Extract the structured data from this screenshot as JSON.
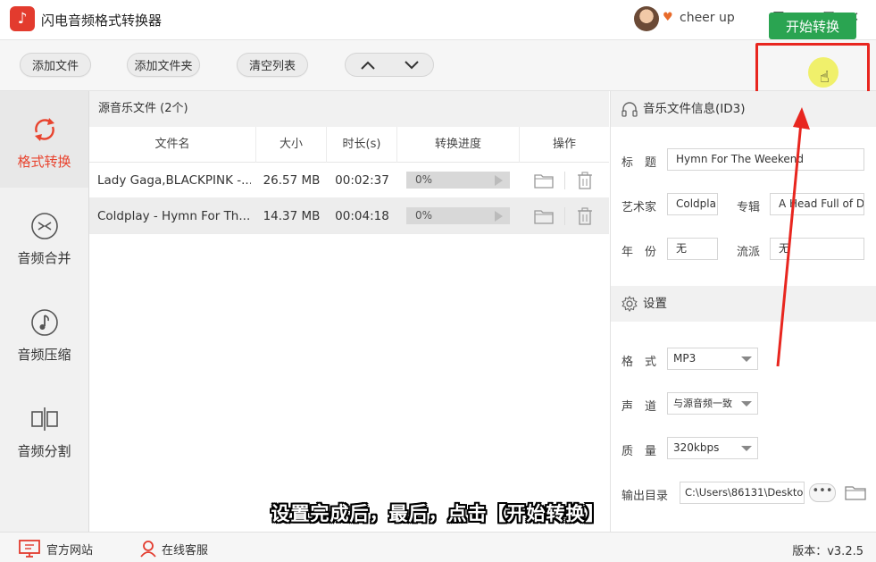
{
  "app": {
    "title": "闪电音频格式转换器",
    "logo_glyph": "♪"
  },
  "user": {
    "name": "cheer up"
  },
  "window_controls": {
    "menu": "☰",
    "minimize": "—",
    "maximize": "☐",
    "close": "✕"
  },
  "toolbar": {
    "add_file": "添加文件",
    "add_folder": "添加文件夹",
    "clear_list": "清空列表",
    "move_up": "︿",
    "move_down": "﹀",
    "start": "开始转换"
  },
  "sidebar": {
    "items": [
      {
        "label": "格式转换",
        "icon": "refresh-icon",
        "active": true
      },
      {
        "label": "音频合并",
        "icon": "merge-icon",
        "active": false
      },
      {
        "label": "音频压缩",
        "icon": "music-note-icon",
        "active": false
      },
      {
        "label": "音频分割",
        "icon": "split-icon",
        "active": false
      }
    ]
  },
  "file_list": {
    "header": "源音乐文件 (2个)",
    "columns": [
      "文件名",
      "大小",
      "时长(s)",
      "转换进度",
      "操作"
    ],
    "rows": [
      {
        "name": "Lady Gaga,BLACKPINK -...",
        "size": "26.57 MB",
        "duration": "00:02:37",
        "progress": "0%"
      },
      {
        "name": "Coldplay - Hymn For Th...",
        "size": "14.37 MB",
        "duration": "00:04:18",
        "progress": "0%"
      }
    ]
  },
  "info": {
    "header": "音乐文件信息(ID3)",
    "title_label": "标　题",
    "title_value": "Hymn For The Weekend",
    "artist_label": "艺术家",
    "artist_value": "Coldpla",
    "album_label": "专辑",
    "album_value": "A Head Full of D",
    "year_label": "年　份",
    "year_value": "无",
    "genre_label": "流派",
    "genre_value": "无"
  },
  "settings": {
    "header": "设置",
    "format_label": "格　式",
    "format_value": "MP3",
    "channel_label": "声　道",
    "channel_value": "与源音频一致",
    "quality_label": "质　量",
    "quality_value": "320kbps",
    "output_label": "输出目录",
    "output_value": "C:\\Users\\86131\\Deskto",
    "dots": "•••"
  },
  "caption": "设置完成后，最后，点击【开始转换】",
  "status": {
    "website": "官方网站",
    "support": "在线客服",
    "version": "版本：v3.2.5"
  },
  "colors": {
    "accent_red": "#e8442f",
    "start_green": "#2aa451",
    "annotation_red": "#e8261f"
  }
}
